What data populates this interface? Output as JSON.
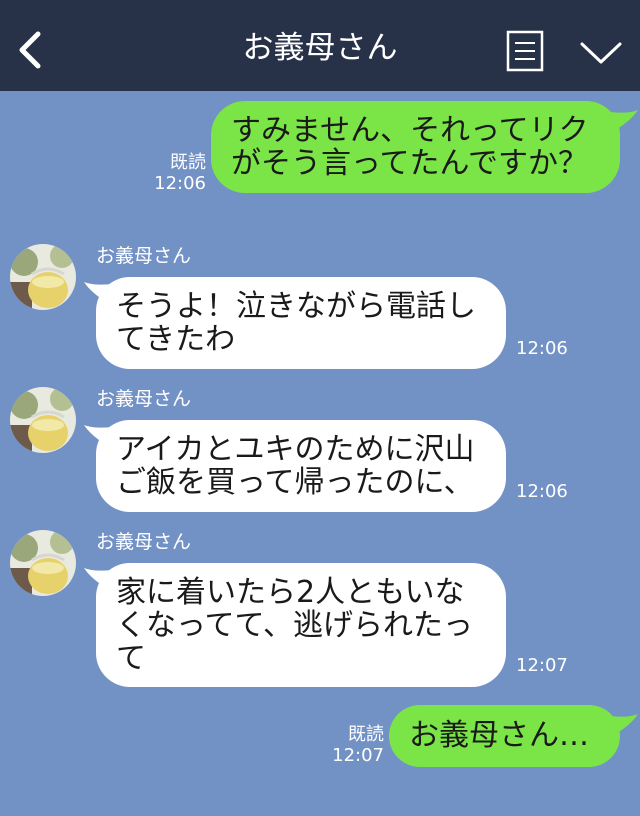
{
  "header": {
    "title": "お義母さん",
    "back_icon": "chevron-left-icon",
    "menu_icon": "menu-icon",
    "expand_icon": "chevron-down-icon",
    "bg_color": "#273248"
  },
  "chat_bg_color": "#7292c6",
  "messages": [
    {
      "side": "outgoing",
      "lines": [
        "すみません、それってリク",
        "がそう言ってたんですか？"
      ],
      "read": "既読",
      "time": "12:06"
    },
    {
      "side": "incoming",
      "sender": "お義母さん",
      "lines": [
        "そうよ！泣きながら電話し",
        "てきたわ"
      ],
      "time": "12:06"
    },
    {
      "side": "incoming",
      "sender": "お義母さん",
      "lines": [
        "アイカとユキのために沢山",
        "ご飯を買って帰ったのに、"
      ],
      "time": "12:06"
    },
    {
      "side": "incoming",
      "sender": "お義母さん",
      "lines": [
        "家に着いたら2人ともいな",
        "くなってて、逃げられたっ",
        "て"
      ],
      "time": "12:07"
    },
    {
      "side": "outgoing",
      "lines": [
        "お義母さん…"
      ],
      "read": "既読",
      "time": "12:07"
    }
  ],
  "colors": {
    "outgoing_bubble": "#7be547",
    "incoming_bubble": "#ffffff"
  }
}
